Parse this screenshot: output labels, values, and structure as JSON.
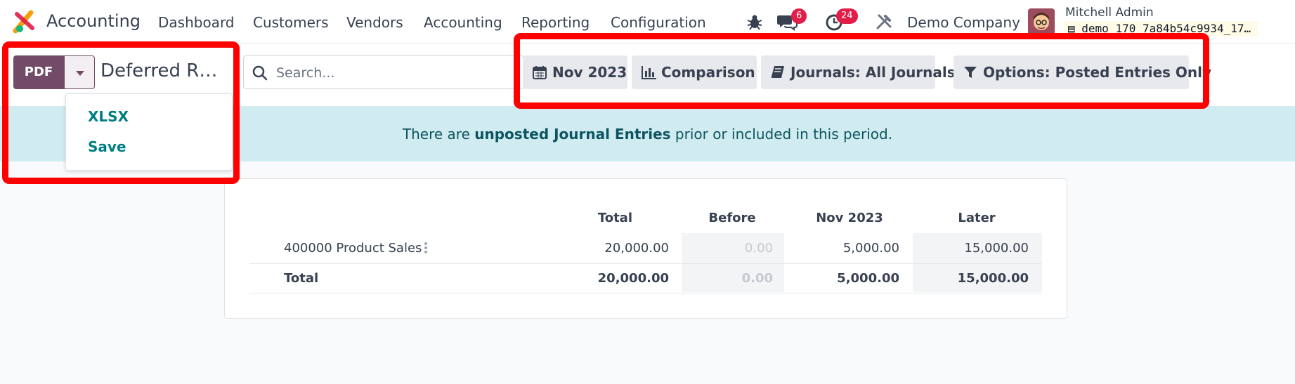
{
  "navbar": {
    "app_name": "Accounting",
    "menu": [
      "Dashboard",
      "Customers",
      "Vendors",
      "Accounting",
      "Reporting",
      "Configuration"
    ],
    "messages_count": "6",
    "activities_count": "24",
    "company": "Demo Company",
    "user_name": "Mitchell Admin",
    "database": "demo_170_7a84b54c9934_17…"
  },
  "control_panel": {
    "pdf_label": "PDF",
    "report_title": "Deferred R…",
    "search_placeholder": "Search...",
    "filters": {
      "period": "Nov 2023",
      "comparison": "Comparison",
      "journals": "Journals: All Journals",
      "options": "Options: Posted Entries Only"
    }
  },
  "export_menu": {
    "items": [
      "XLSX",
      "Save"
    ]
  },
  "alert": {
    "prefix": "There are ",
    "link": "unposted Journal Entries",
    "suffix": " prior or included in this period."
  },
  "report": {
    "columns": [
      "Total",
      "Before",
      "Nov 2023",
      "Later"
    ],
    "rows": [
      {
        "label": "400000 Product Sales",
        "values": [
          "20,000.00",
          "0.00",
          "5,000.00",
          "15,000.00"
        ]
      },
      {
        "label": "Total",
        "values": [
          "20,000.00",
          "0.00",
          "5,000.00",
          "15,000.00"
        ]
      }
    ]
  },
  "colors": {
    "brand": "#714b67",
    "link": "#017e84",
    "alert_bg": "#d1ecf1",
    "badge": "#e11d48",
    "annotation": "#ff0000"
  }
}
